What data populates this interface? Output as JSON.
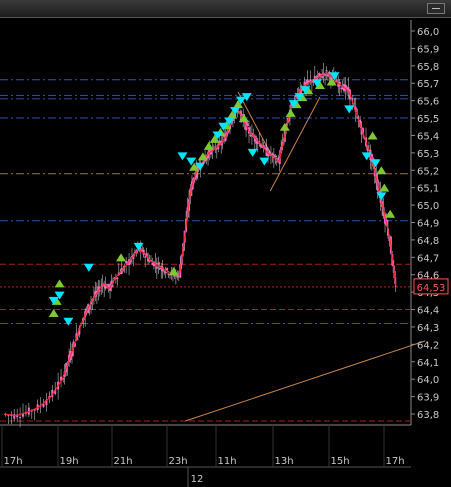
{
  "chart_data": {
    "type": "candlestick",
    "title": "",
    "last_price_label": "64,53",
    "y_ticks": [
      "66,0",
      "65,9",
      "65,8",
      "65,7",
      "65,6",
      "65,5",
      "65,4",
      "65,3",
      "65,2",
      "65,1",
      "65,0",
      "64,9",
      "64,8",
      "64,7",
      "64,6",
      "64,5",
      "64,4",
      "64,3",
      "64,2",
      "64,1",
      "64,0",
      "63,9",
      "63,8"
    ],
    "ylim": [
      63.75,
      66.04
    ],
    "x_ticks": [
      "17h",
      "19h",
      "21h",
      "23h",
      "11h",
      "13h",
      "15h",
      "17h"
    ],
    "x_date_label": "12",
    "grid": false,
    "colors": {
      "background": "#000000",
      "candle": "#ff66cc",
      "wick": "#ffffff",
      "marker_up": "#7ec832",
      "marker_down": "#00e5ff",
      "trend_line": "#c8824a",
      "level_red": "#a32020",
      "level_blue": "#2a55b0",
      "level_orange": "#b86a1c",
      "price_line": "#ff3030",
      "price_label": "#ff5555"
    },
    "horizontal_levels": [
      {
        "value": 65.72,
        "color": "level_blue"
      },
      {
        "value": 65.63,
        "color": "level_blue"
      },
      {
        "value": 65.61,
        "color": "level_blue"
      },
      {
        "value": 65.5,
        "color": "level_blue"
      },
      {
        "value": 65.18,
        "color": "level_orange"
      },
      {
        "value": 64.91,
        "color": "level_blue"
      },
      {
        "value": 64.66,
        "color": "level_red"
      },
      {
        "value": 64.4,
        "color": "level_red"
      },
      {
        "value": 64.32,
        "color": "level_blue"
      },
      {
        "value": 63.76,
        "color": "level_red"
      }
    ],
    "close_path": [
      [
        0,
        63.8
      ],
      [
        2,
        63.79
      ],
      [
        4,
        63.81
      ],
      [
        6,
        63.84
      ],
      [
        8,
        63.9
      ],
      [
        10,
        64.0
      ],
      [
        11,
        64.1
      ],
      [
        12,
        64.2
      ],
      [
        13,
        64.3
      ],
      [
        14,
        64.38
      ],
      [
        15,
        64.45
      ],
      [
        16,
        64.5
      ],
      [
        17,
        64.55
      ],
      [
        18,
        64.52
      ],
      [
        19,
        64.58
      ],
      [
        20,
        64.62
      ],
      [
        21,
        64.66
      ],
      [
        22,
        64.7
      ],
      [
        23,
        64.75
      ],
      [
        24,
        64.72
      ],
      [
        25,
        64.68
      ],
      [
        26,
        64.66
      ],
      [
        27,
        64.64
      ],
      [
        28,
        64.62
      ],
      [
        29,
        64.6
      ],
      [
        30,
        64.6
      ],
      [
        31,
        64.85
      ],
      [
        32,
        65.1
      ],
      [
        33,
        65.2
      ],
      [
        34,
        65.25
      ],
      [
        35,
        65.3
      ],
      [
        36,
        65.32
      ],
      [
        37,
        65.35
      ],
      [
        38,
        65.4
      ],
      [
        39,
        65.5
      ],
      [
        40,
        65.55
      ],
      [
        41,
        65.48
      ],
      [
        42,
        65.42
      ],
      [
        43,
        65.38
      ],
      [
        44,
        65.35
      ],
      [
        45,
        65.3
      ],
      [
        46,
        65.28
      ],
      [
        47,
        65.25
      ],
      [
        48,
        65.4
      ],
      [
        49,
        65.55
      ],
      [
        50,
        65.62
      ],
      [
        51,
        65.68
      ],
      [
        52,
        65.7
      ],
      [
        53,
        65.72
      ],
      [
        54,
        65.74
      ],
      [
        55,
        65.76
      ],
      [
        56,
        65.74
      ],
      [
        57,
        65.7
      ],
      [
        58,
        65.68
      ],
      [
        59,
        65.65
      ],
      [
        60,
        65.55
      ],
      [
        61,
        65.45
      ],
      [
        62,
        65.35
      ],
      [
        63,
        65.25
      ],
      [
        64,
        65.1
      ],
      [
        65,
        64.95
      ],
      [
        66,
        64.8
      ],
      [
        67,
        64.53
      ]
    ],
    "trend_lines": [
      {
        "from": [
          31,
          63.76
        ],
        "to": [
          72,
          64.22
        ]
      },
      {
        "from": [
          45.5,
          65.08
        ],
        "to": [
          54,
          65.62
        ]
      },
      {
        "from": [
          40,
          65.65
        ],
        "to": [
          45.5,
          65.3
        ]
      }
    ],
    "markers_up": [
      [
        8.5,
        64.38
      ],
      [
        9,
        64.45
      ],
      [
        9.5,
        64.55
      ],
      [
        20,
        64.7
      ],
      [
        29,
        64.62
      ],
      [
        32.5,
        65.22
      ],
      [
        34,
        65.28
      ],
      [
        35,
        65.34
      ],
      [
        36,
        65.38
      ],
      [
        37,
        65.42
      ],
      [
        38,
        65.46
      ],
      [
        39,
        65.52
      ],
      [
        40,
        65.58
      ],
      [
        41,
        65.5
      ],
      [
        48,
        65.45
      ],
      [
        49,
        65.53
      ],
      [
        50,
        65.58
      ],
      [
        51,
        65.62
      ],
      [
        52,
        65.66
      ],
      [
        54,
        65.69
      ],
      [
        56,
        65.71
      ],
      [
        63,
        65.4
      ],
      [
        64.5,
        65.2
      ],
      [
        65,
        65.1
      ],
      [
        66,
        64.95
      ]
    ],
    "markers_down": [
      [
        8.5,
        64.45
      ],
      [
        9.5,
        64.48
      ],
      [
        11,
        64.33
      ],
      [
        14.5,
        64.64
      ],
      [
        23,
        64.76
      ],
      [
        30.5,
        65.28
      ],
      [
        32,
        65.25
      ],
      [
        33.5,
        65.22
      ],
      [
        36.5,
        65.4
      ],
      [
        37.5,
        65.45
      ],
      [
        38.5,
        65.48
      ],
      [
        39.5,
        65.54
      ],
      [
        40.5,
        65.6
      ],
      [
        41.5,
        65.62
      ],
      [
        42.5,
        65.3
      ],
      [
        44.5,
        65.25
      ],
      [
        49.5,
        65.58
      ],
      [
        50.5,
        65.62
      ],
      [
        51.5,
        65.66
      ],
      [
        53.5,
        65.7
      ],
      [
        56.5,
        65.74
      ],
      [
        59,
        65.55
      ],
      [
        62,
        65.28
      ],
      [
        63.5,
        65.24
      ],
      [
        64.5,
        65.05
      ]
    ]
  }
}
